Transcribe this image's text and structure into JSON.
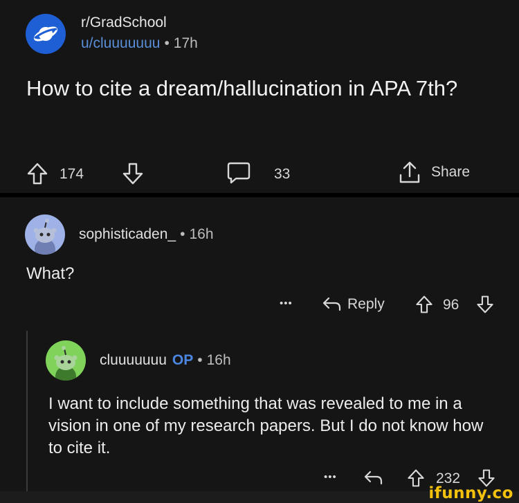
{
  "post": {
    "subreddit": "r/GradSchool",
    "author": "u/cluuuuuuu",
    "separator": "•",
    "time": "17h",
    "title": "How to cite a dream/hallucination in APA 7th?",
    "upvotes": "174",
    "comments": "33",
    "share_label": "Share",
    "icon": "planet-icon"
  },
  "comments": [
    {
      "author": "sophisticaden_",
      "separator": "•",
      "time": "16h",
      "body": "What?",
      "more_label": "•••",
      "reply_label": "Reply",
      "votes": "96",
      "avatar_color": "#9fb2e8"
    },
    {
      "author": "cluuuuuuu",
      "op_label": "OP",
      "separator": "•",
      "time": "16h",
      "body": "I want to include something that was revealed to me in a vision in one of my research papers. But I do not know how to cite it.",
      "more_label": "•••",
      "votes": "232",
      "avatar_color": "#7fd35a"
    }
  ],
  "watermark": "ifunny.co",
  "colors": {
    "background": "#151515",
    "link_blue": "#5a8fd8",
    "op_blue": "#4a86e0",
    "subreddit_icon": "#1f5fd6",
    "watermark_yellow": "#f4c20d"
  }
}
